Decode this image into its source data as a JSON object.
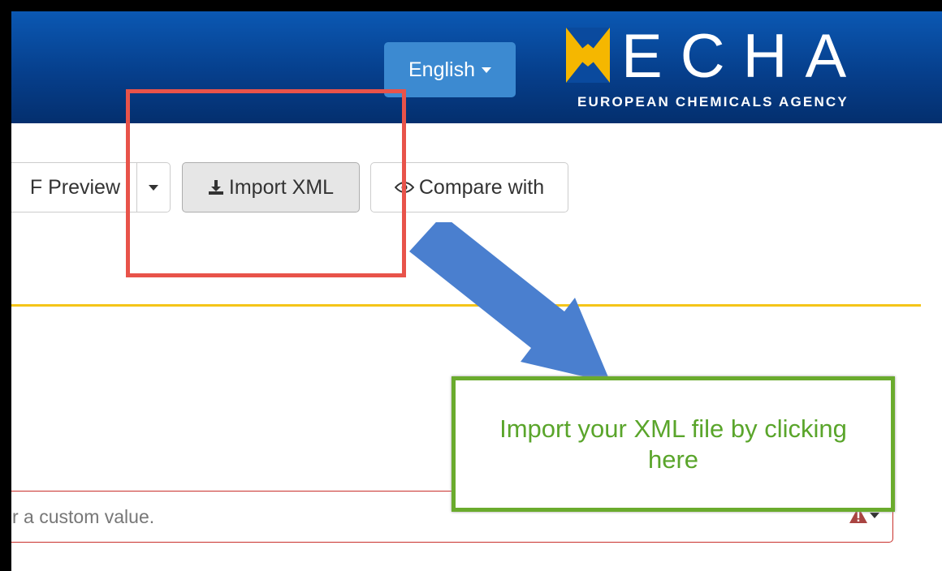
{
  "header": {
    "language_label": "English",
    "logo": {
      "wordmark": "ECHA",
      "subtitle": "EUROPEAN CHEMICALS AGENCY"
    }
  },
  "toolbar": {
    "pdf_preview_label": "F Preview",
    "import_label": "Import XML",
    "compare_label": "Compare with"
  },
  "annotation": {
    "callout_text": "Import your XML file by clicking here",
    "highlight_color": "#e8534a",
    "callout_color": "#6aab2d",
    "arrow_color": "#4a7fcf"
  },
  "form": {
    "field_text": "r a custom value.",
    "status_color": "#c9302c"
  },
  "colors": {
    "header": "#063f8c",
    "language_button": "#3c8ad1",
    "divider": "#f5c518"
  }
}
